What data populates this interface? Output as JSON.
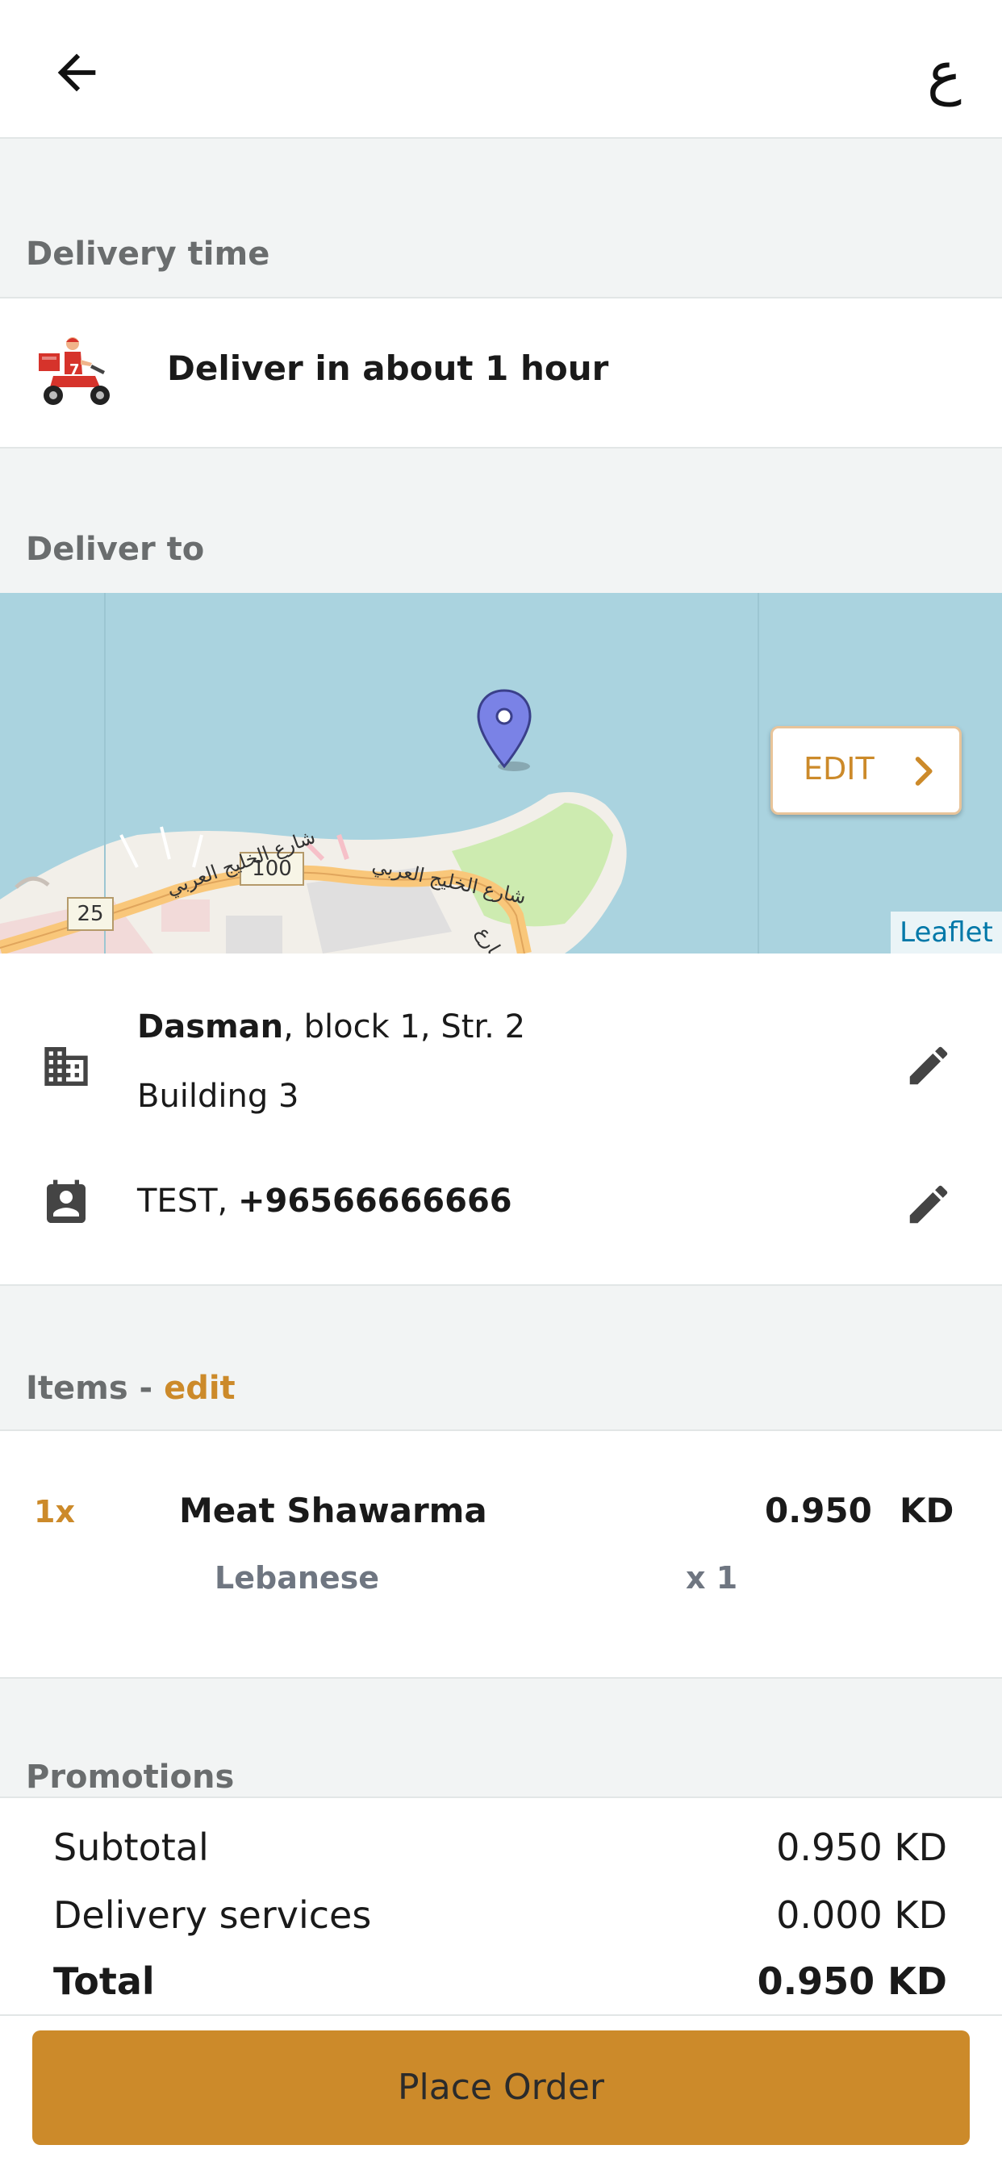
{
  "header": {
    "lang_toggle": "ع",
    "back_icon": "arrow-left-icon"
  },
  "delivery_time": {
    "title": "Delivery time",
    "text": "Deliver in about 1 hour",
    "icon": "delivery-scooter-icon"
  },
  "deliver_to": {
    "title": "Deliver to",
    "map": {
      "edit_label": "EDIT",
      "attribution": "Leaflet",
      "road_labels": [
        "100",
        "25",
        "شارع الخليج العربي",
        "شارع الخليج العربي",
        "شارع"
      ]
    },
    "address": {
      "area": "Dasman",
      "rest": ", block 1, Str. 2",
      "line2": "Building 3"
    },
    "contact": {
      "name": "TEST, ",
      "phone": "+96566666666"
    }
  },
  "items": {
    "title": "Items - ",
    "edit_label": "edit",
    "list": [
      {
        "qty": "1x",
        "name": "Meat Shawarma",
        "price": "0.950",
        "currency": "KD",
        "option": "Lebanese",
        "option_qty": "x 1"
      }
    ]
  },
  "promotions": {
    "title": "Promotions"
  },
  "totals": {
    "subtotal_label": "Subtotal",
    "subtotal_value": "0.950 KD",
    "delivery_label": "Delivery services",
    "delivery_value": "0.000 KD",
    "total_label": "Total",
    "total_value": "0.950 KD"
  },
  "footer": {
    "place_order_label": "Place Order"
  },
  "colors": {
    "accent": "#cc8a2a",
    "background": "#f2f4f4",
    "map_water": "#aad3df"
  }
}
